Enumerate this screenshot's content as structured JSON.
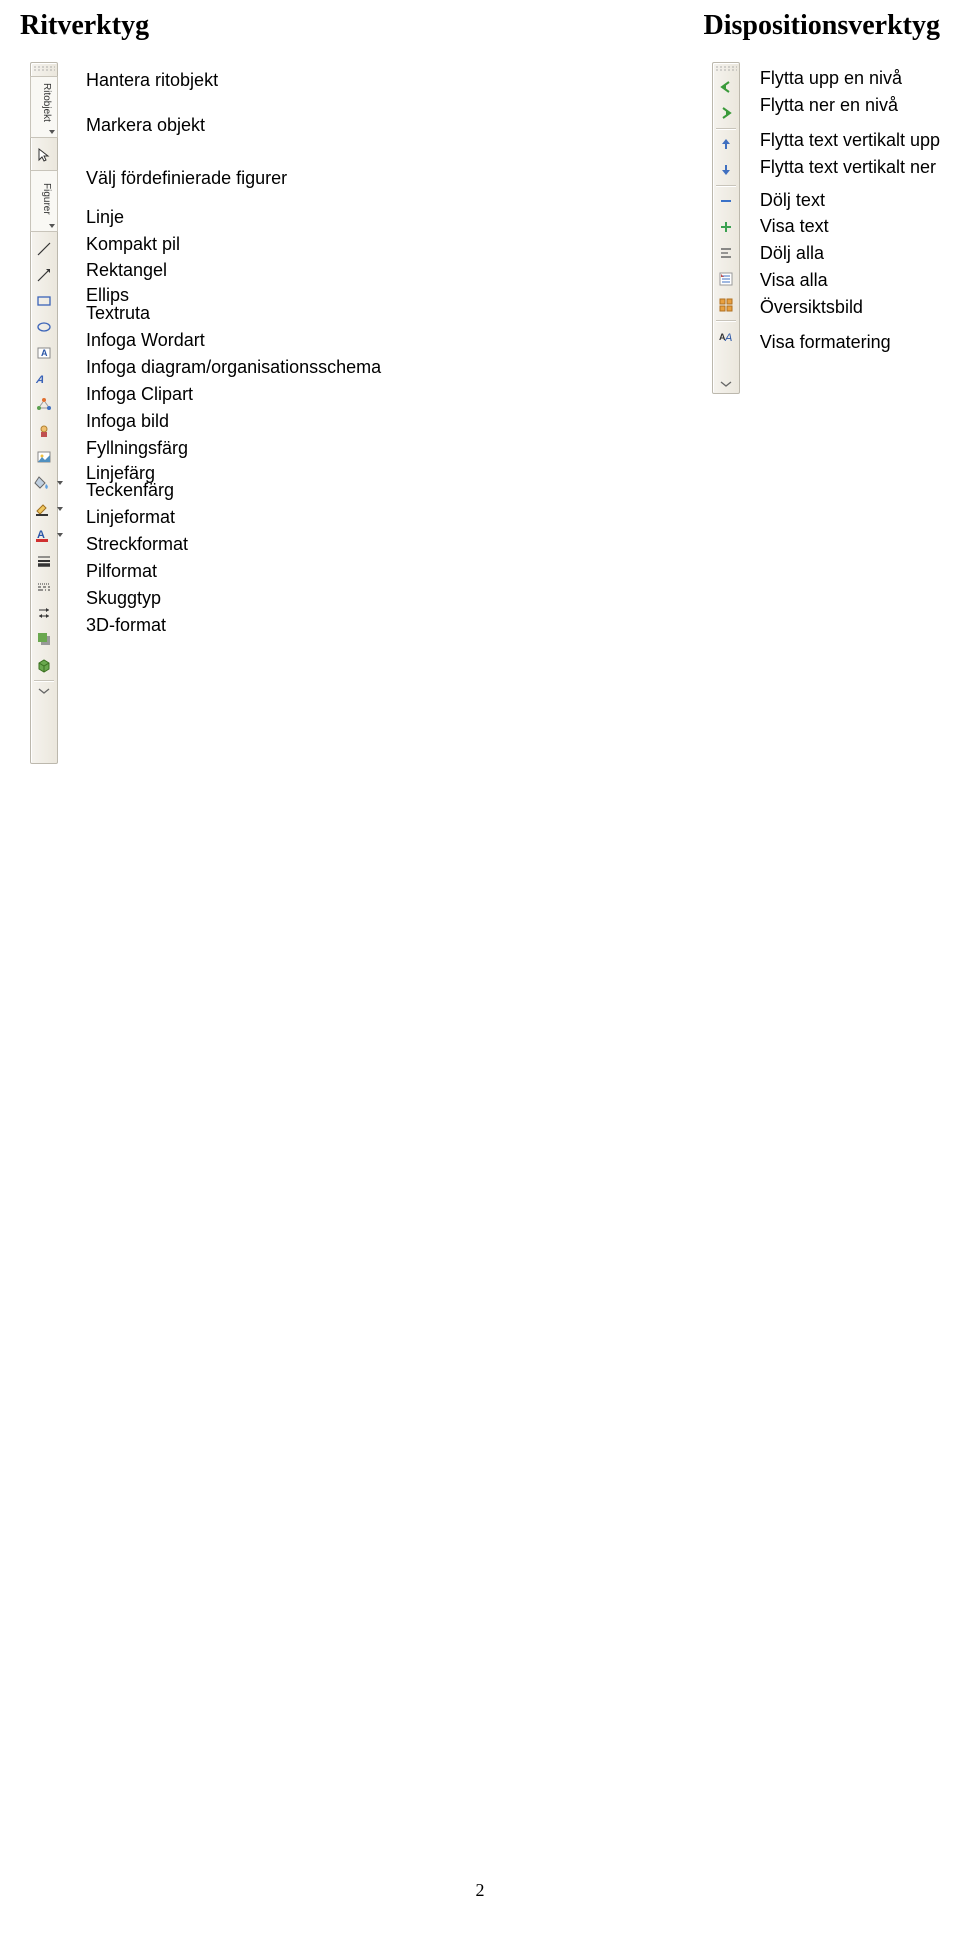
{
  "headers": {
    "left": "Ritverktyg",
    "right": "Dispositionsverktyg"
  },
  "left_toolbar": {
    "items": [
      {
        "id": "ritobjekt-handle",
        "label": "Hantera ritobjekt"
      },
      {
        "id": "markera-objekt",
        "label": "Markera objekt"
      },
      {
        "id": "fordefinierade-figurer",
        "label": "Välj fördefinierade figurer"
      },
      {
        "id": "linje",
        "label": "Linje"
      },
      {
        "id": "kompakt-pil",
        "label": "Kompakt pil"
      },
      {
        "id": "rektangel",
        "label": "Rektangel"
      },
      {
        "id": "ellips",
        "label": "Ellips"
      },
      {
        "id": "textruta",
        "label": "Textruta"
      },
      {
        "id": "infoga-wordart",
        "label": "Infoga Wordart"
      },
      {
        "id": "infoga-diagram",
        "label": "Infoga diagram/organisationsschema"
      },
      {
        "id": "infoga-clipart",
        "label": "Infoga Clipart"
      },
      {
        "id": "infoga-bild",
        "label": "Infoga bild"
      },
      {
        "id": "fyllningsfarg",
        "label": "Fyllningsfärg"
      },
      {
        "id": "linjefarg",
        "label": "Linjefärg"
      },
      {
        "id": "teckenfarg",
        "label": "Teckenfärg"
      },
      {
        "id": "linjeformat",
        "label": "Linjeformat"
      },
      {
        "id": "streckformat",
        "label": "Streckformat"
      },
      {
        "id": "pilformat",
        "label": "Pilformat"
      },
      {
        "id": "skuggtyp",
        "label": "Skuggtyp"
      },
      {
        "id": "3d-format",
        "label": "3D-format"
      }
    ],
    "handle_text_1": "Ritobjekt",
    "handle_text_2": "Figurer"
  },
  "right_toolbar": {
    "items": [
      {
        "id": "flytta-upp-niva",
        "label": "Flytta upp en nivå"
      },
      {
        "id": "flytta-ner-niva",
        "label": "Flytta ner en nivå"
      },
      {
        "id": "flytta-text-upp",
        "label": "Flytta text vertikalt upp"
      },
      {
        "id": "flytta-text-ner",
        "label": "Flytta text vertikalt ner"
      },
      {
        "id": "dolj-text",
        "label": "Dölj text"
      },
      {
        "id": "visa-text",
        "label": "Visa text"
      },
      {
        "id": "dolj-alla",
        "label": "Dölj alla"
      },
      {
        "id": "visa-alla",
        "label": "Visa alla"
      },
      {
        "id": "oversiktsbild",
        "label": "Översiktsbild"
      },
      {
        "id": "visa-formatering",
        "label": "Visa formatering"
      }
    ]
  },
  "page_number": "2"
}
